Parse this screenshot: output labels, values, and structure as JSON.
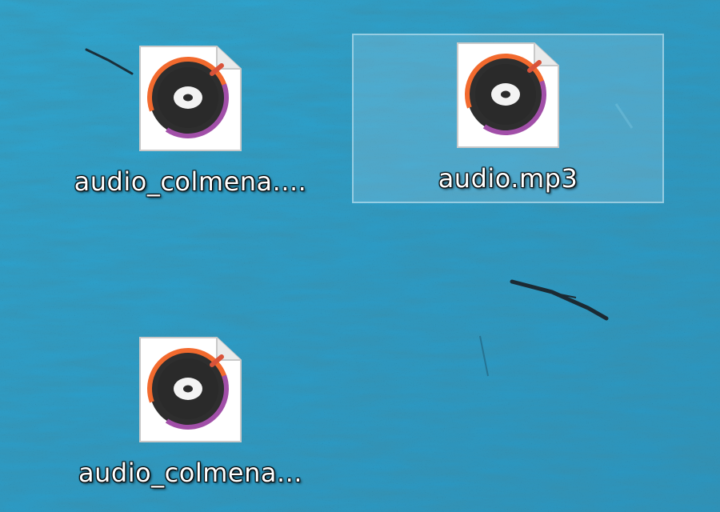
{
  "desktop": {
    "background_color": "#2b9fc9",
    "icons": [
      {
        "label": "audio_colmena....",
        "icon": "music-disc-file-icon",
        "selected": false
      },
      {
        "label": "audio.mp3",
        "icon": "music-disc-file-icon",
        "selected": true
      },
      {
        "label": "audio_colmena...",
        "icon": "music-disc-file-icon",
        "selected": false
      }
    ]
  }
}
